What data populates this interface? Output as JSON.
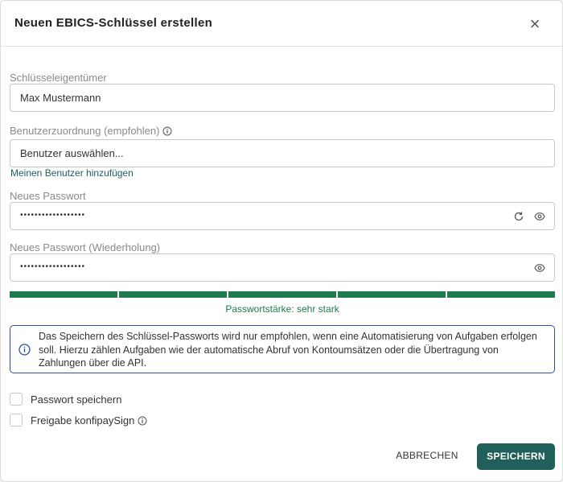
{
  "dialog": {
    "title": "Neuen EBICS-Schlüssel erstellen",
    "close_icon": "close-icon"
  },
  "owner": {
    "label": "Schlüsseleigentümer",
    "value": "Max Mustermann"
  },
  "user_assignment": {
    "label": "Benutzerzuordnung (empfohlen)",
    "placeholder": "Benutzer auswählen...",
    "link": "Meinen Benutzer hinzufügen"
  },
  "new_password": {
    "label": "Neues Passwort",
    "value": "••••••••••••••••••"
  },
  "repeat_password": {
    "label": "Neues Passwort (Wiederholung)",
    "value": "••••••••••••••••••"
  },
  "strength": {
    "segments_filled": 5,
    "segments_total": 5,
    "text": "Passwortstärke: sehr stark",
    "color": "#1f7a4d"
  },
  "info": {
    "text": "Das Speichern des Schlüssel-Passworts wird nur empfohlen, wenn eine Automatisierung von Aufgaben erfolgen soll. Hierzu zählen Aufgaben wie der automatische Abruf von Kontoumsätzen oder die Übertragung von Zahlungen über die API.",
    "border_color": "#2f4fa2"
  },
  "options": {
    "save_password": "Passwort speichern",
    "konfipay_sign": "Freigabe konfipaySign"
  },
  "buttons": {
    "cancel": "ABBRECHEN",
    "save": "SPEICHERN",
    "save_color": "#205f5a"
  }
}
